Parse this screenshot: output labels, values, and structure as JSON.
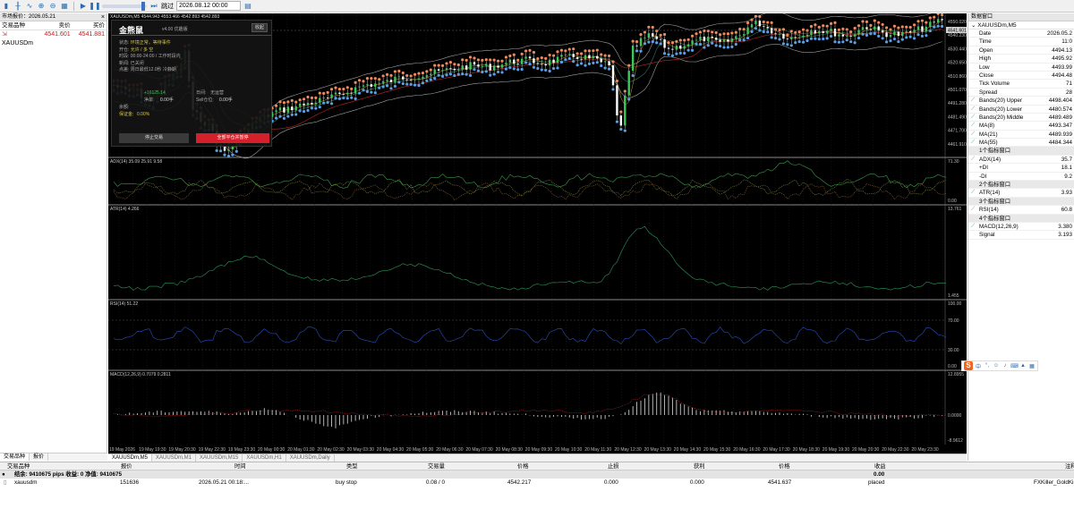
{
  "toolbar": {
    "jump_label": "跳过",
    "date_value": "2026.08.12 00:00"
  },
  "market_watch": {
    "title": "市场报价：2026.05.21",
    "columns": [
      "交易品种",
      "卖价",
      "买价"
    ],
    "rows": [
      {
        "symbol": "XAUUSDm",
        "bid": "4541.601",
        "ask": "4541.881"
      }
    ],
    "tabs": [
      "交易品种",
      "报价"
    ]
  },
  "chart": {
    "header": "XAUUSDm,M5  4544.943 4553.466 4542.893 4542.893",
    "subwindows": [
      {
        "label": "ADX(14) 35.09 25.91 9.58",
        "scale_top": "71.30",
        "scale_bottom": "0.00"
      },
      {
        "label": "ATR(14) 4.266",
        "scale_top": "13.761",
        "scale_bottom": "1.455"
      },
      {
        "label": "RSI(14) 51.22",
        "scale_top": "100.00",
        "scale_mid_high": "70.00",
        "scale_mid_low": "30.00",
        "scale_bottom": "0.00"
      },
      {
        "label": "MACD(12,26,9) 0.7079 0.2811",
        "scale_top": "12.8955",
        "scale_mid": "0.0000",
        "scale_bottom": "-8.9612"
      }
    ],
    "price_scale": [
      "4550.020",
      "4540.230",
      "4530.440",
      "4520.650",
      "4510.860",
      "4501.070",
      "4491.280",
      "4481.490",
      "4471.700",
      "4461.910"
    ],
    "current_price": "4541.601",
    "time_labels": [
      "19 May 2026",
      "19 May 19:30",
      "19 May 20:30",
      "19 May 22:30",
      "19 May 23:30",
      "20 May 00:30",
      "20 May 01:30",
      "20 May 02:30",
      "20 May 03:30",
      "20 May 04:30",
      "20 May 05:30",
      "20 May 06:30",
      "20 May 07:30",
      "20 May 08:30",
      "20 May 09:30",
      "20 May 10:30",
      "20 May 11:30",
      "20 May 12:30",
      "20 May 13:30",
      "20 May 14:30",
      "20 May 15:30",
      "20 May 16:30",
      "20 May 17:30",
      "20 May 18:30",
      "20 May 19:30",
      "20 May 20:30",
      "20 May 22:30",
      "20 May 23:30"
    ],
    "tabs": [
      "XAUUSDm,M5",
      "XAUUSDm,M1",
      "XAUUSDm,M15",
      "XAUUSDm,H1",
      "XAUUSDm,Daily"
    ]
  },
  "ea_panel": {
    "title": "金熊鼠",
    "version": "v4.00 优趣版",
    "collapse_label": "收起",
    "info_lines": [
      {
        "k": "状态:",
        "v": "环境正常，等待事件"
      },
      {
        "k": "开仓:",
        "v": "允许 / 多  空"
      },
      {
        "k": "时段:",
        "v": "00:00-24:00 / 工作时段内"
      },
      {
        "k": "新闻:",
        "v": "已关闭"
      },
      {
        "k": "点差:",
        "v": "周日最低12.0秒 冷静期"
      }
    ],
    "stats": {
      "profit_value": "+16125.14",
      "net_label": "净单",
      "net_value": "0.00手",
      "date_label": "日间:",
      "date_value": "无运营",
      "sell_label": "Sell仓位:",
      "sell_value": "0.00手",
      "order_label": "余额:",
      "margin_label": "保证金:",
      "margin_value": "0.00%"
    },
    "stop_button": "停止交易",
    "close_button": "全部平仓并暂停"
  },
  "data_window": {
    "title": "数据窗口",
    "symbol": "XAUUSDm,M5",
    "rows": [
      {
        "k": "Date",
        "v": "2026.05.2"
      },
      {
        "k": "Time",
        "v": "11:0"
      },
      {
        "k": "Open",
        "v": "4494.13"
      },
      {
        "k": "High",
        "v": "4495.92"
      },
      {
        "k": "Low",
        "v": "4493.99"
      },
      {
        "k": "Close",
        "v": "4494.48"
      },
      {
        "k": "Tick Volume",
        "v": "71"
      },
      {
        "k": "Spread",
        "v": "28"
      },
      {
        "k": "Bands(20) Upper",
        "v": "4498.404",
        "ico": true
      },
      {
        "k": "Bands(20) Lower",
        "v": "4480.574",
        "ico": true
      },
      {
        "k": "Bands(20) Middle",
        "v": "4489.489",
        "ico": true
      },
      {
        "k": "MA(8)",
        "v": "4493.347",
        "ico": true
      },
      {
        "k": "MA(21)",
        "v": "4489.939",
        "ico": true
      },
      {
        "k": "MA(55)",
        "v": "4484.344",
        "ico": true
      },
      {
        "k": "1个指标窗口",
        "v": "",
        "grp": true
      },
      {
        "k": "ADX(14)",
        "v": "35.7",
        "ico": true
      },
      {
        "k": "+DI",
        "v": "18.1"
      },
      {
        "k": "-DI",
        "v": "9.2"
      },
      {
        "k": "2个指标窗口",
        "v": "",
        "grp": true
      },
      {
        "k": "ATR(14)",
        "v": "3.93",
        "ico": true
      },
      {
        "k": "3个指标窗口",
        "v": "",
        "grp": true
      },
      {
        "k": "RSI(14)",
        "v": "60.8",
        "ico": true
      },
      {
        "k": "4个指标窗口",
        "v": "",
        "grp": true
      },
      {
        "k": "MACD(12,26,9)",
        "v": "3.380",
        "ico": true
      },
      {
        "k": "Signal",
        "v": "3.193"
      }
    ]
  },
  "trade_panel": {
    "columns": [
      "交易品种",
      "报价",
      "时间",
      "类型",
      "交易量",
      "价格",
      "止损",
      "获利",
      "价格",
      "收益",
      "注释"
    ],
    "summary": "结余: 9410675 pips  收益: 0  净值: 9410675",
    "summary_profit": "0.00",
    "orders": [
      {
        "symbol": "xauusdm",
        "ticket": "151636",
        "time": "2026.05.21 00:18:...",
        "type": "buy stop",
        "volume": "0.08 / 0",
        "price": "4542.217",
        "sl": "0.000",
        "tp": "0.000",
        "cur_price": "4541.637",
        "profit": "placed",
        "comment": "FXKiller_GoldKin"
      }
    ]
  },
  "colors": {
    "bull": "#3cc85a",
    "bear": "#ffffff",
    "dots_orange": "#f08a5a",
    "dots_blue": "#5aa0e6",
    "bands": "#a0a0a0",
    "ma_red": "#c0282a",
    "ma_green": "#2aa050",
    "rsi": "#2a4fc4",
    "accent_red": "#d4202a"
  }
}
